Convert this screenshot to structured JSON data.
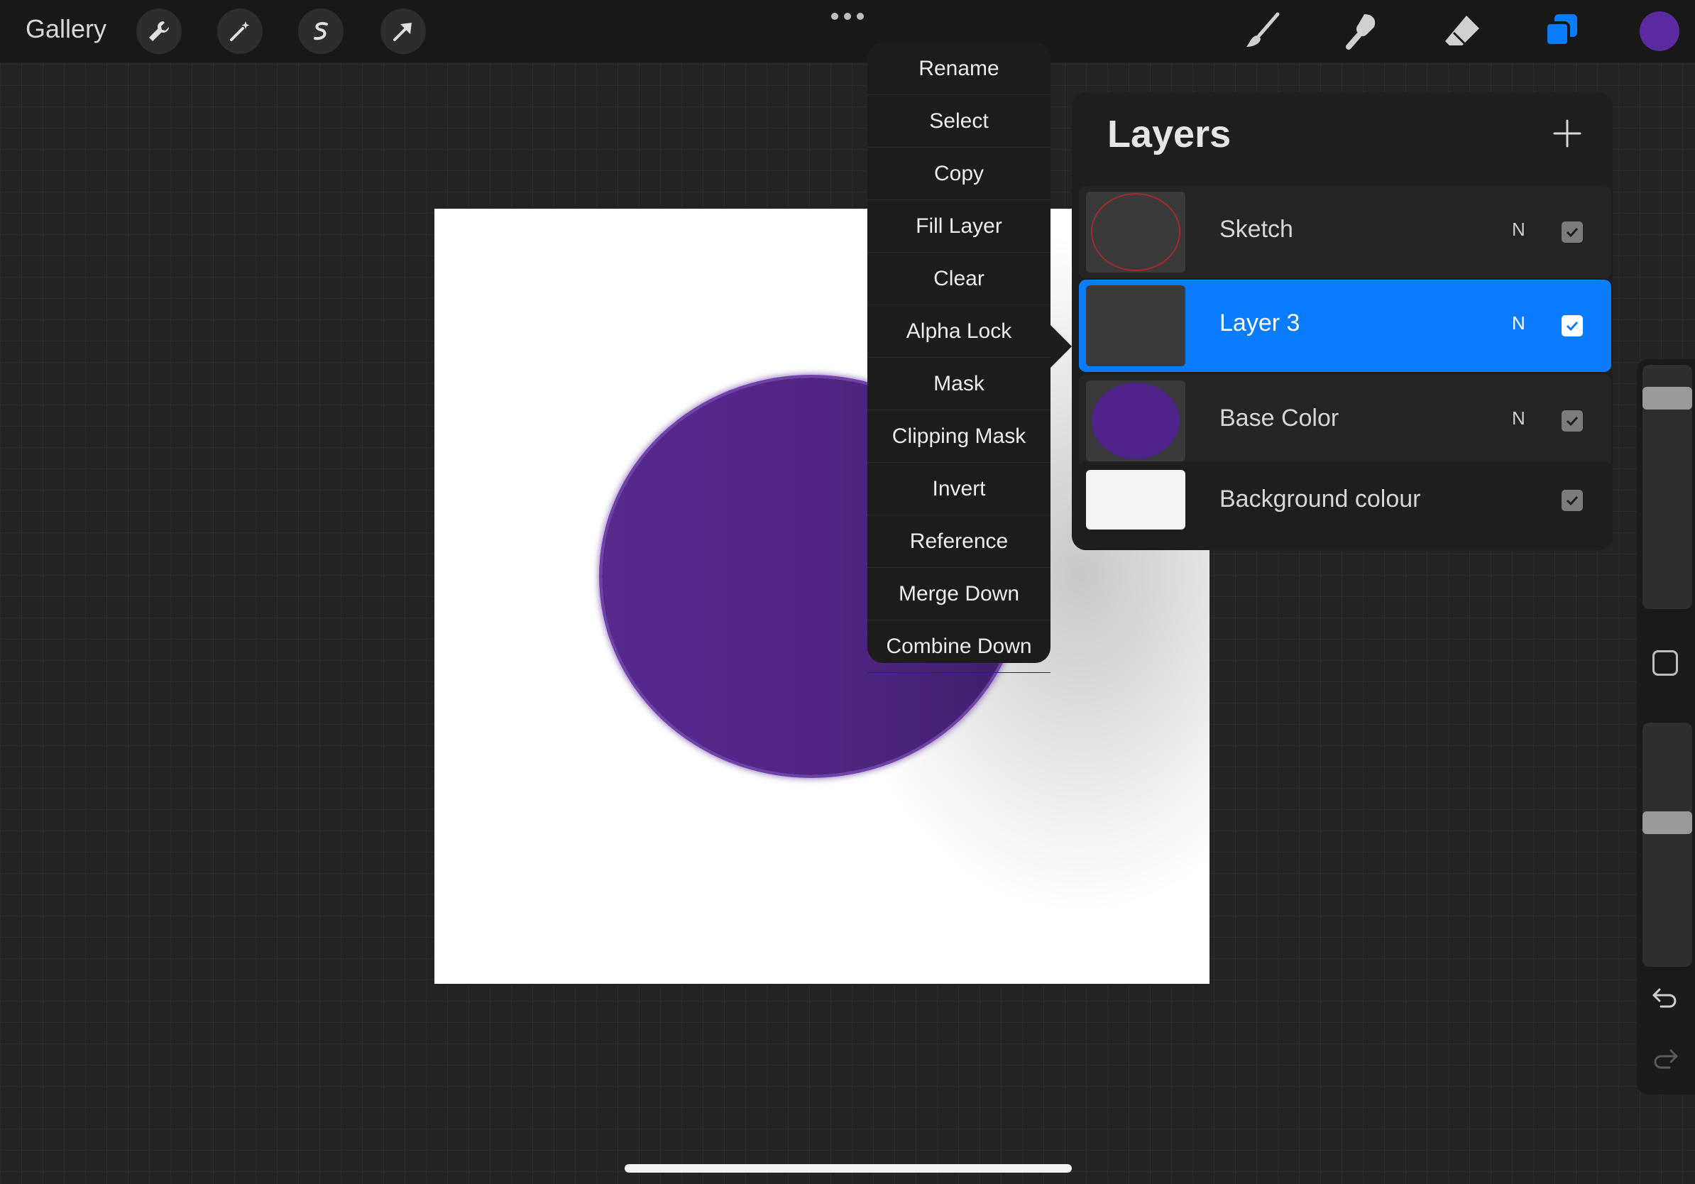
{
  "topbar": {
    "gallery_label": "Gallery",
    "tools_left": [
      "wrench-icon",
      "magic-wand-icon",
      "selection-icon",
      "transform-arrow-icon"
    ],
    "tools_right": [
      "brush-icon",
      "smudge-icon",
      "eraser-icon",
      "layers-icon"
    ],
    "active_color": "#5a2a9e",
    "accent_color": "#0a7cff"
  },
  "context_menu": {
    "items": [
      "Rename",
      "Select",
      "Copy",
      "Fill Layer",
      "Clear",
      "Alpha Lock",
      "Mask",
      "Clipping Mask",
      "Invert",
      "Reference",
      "Merge Down",
      "Combine Down"
    ]
  },
  "layers_panel": {
    "title": "Layers",
    "layers": [
      {
        "name": "Sketch",
        "blend": "N",
        "visible": true,
        "selected": false
      },
      {
        "name": "Layer 3",
        "blend": "N",
        "visible": true,
        "selected": true
      },
      {
        "name": "Base Color",
        "blend": "N",
        "visible": true,
        "selected": false
      },
      {
        "name": "Background colour",
        "blend": "",
        "visible": true,
        "selected": false
      }
    ]
  },
  "sidebar": {
    "brush_size_level": 0.9,
    "opacity_level": 0.6
  }
}
